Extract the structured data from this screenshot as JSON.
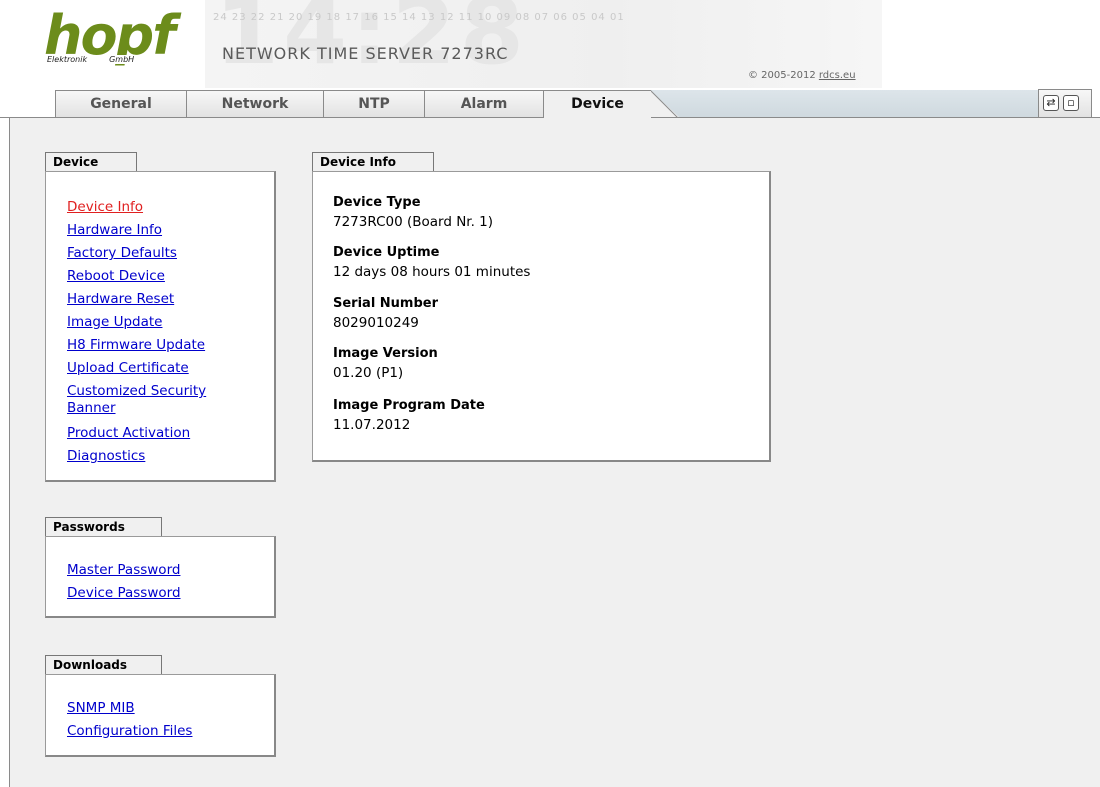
{
  "header": {
    "logo_text": "hopf",
    "logo_sub_left": "Elektronik",
    "logo_sub_right": "GmbH",
    "countdown": "24 23 22 21 20 19 18 17 16 15 14 13 12 11 10 09 08 07 06 05 04 01",
    "bg_clock": "14:28",
    "product_title": "NETWORK TIME SERVER 7273RC",
    "copyright_prefix": "© 2005-2012",
    "copyright_link": "rdcs.eu"
  },
  "tabs": [
    {
      "label": "General"
    },
    {
      "label": "Network"
    },
    {
      "label": "NTP"
    },
    {
      "label": "Alarm"
    },
    {
      "label": "Device"
    }
  ],
  "active_tab": "Device",
  "toolbar_icons": [
    "refresh-icon",
    "page-icon"
  ],
  "sidebar": {
    "device": {
      "title": "Device",
      "items": [
        {
          "label": "Device Info",
          "active": true
        },
        {
          "label": "Hardware Info"
        },
        {
          "label": "Factory Defaults"
        },
        {
          "label": "Reboot Device"
        },
        {
          "label": "Hardware Reset"
        },
        {
          "label": "Image Update"
        },
        {
          "label": "H8 Firmware Update"
        },
        {
          "label": "Upload Certificate"
        },
        {
          "label": "Customized Security"
        },
        {
          "label": "Banner"
        },
        {
          "label": "Product Activation"
        },
        {
          "label": "Diagnostics"
        }
      ]
    },
    "passwords": {
      "title": "Passwords",
      "items": [
        {
          "label": "Master Password"
        },
        {
          "label": "Device Password"
        }
      ]
    },
    "downloads": {
      "title": "Downloads",
      "items": [
        {
          "label": "SNMP MIB"
        },
        {
          "label": "Configuration Files"
        }
      ]
    }
  },
  "device_info": {
    "title": "Device Info",
    "fields": [
      {
        "label": "Device Type",
        "value": "7273RC00 (Board Nr. 1)"
      },
      {
        "label": "Device Uptime",
        "value": "12 days 08 hours 01 minutes"
      },
      {
        "label": "Serial Number",
        "value": "8029010249"
      },
      {
        "label": "Image Version",
        "value": "01.20 (P1)"
      },
      {
        "label": "Image Program Date",
        "value": "11.07.2012"
      }
    ]
  }
}
